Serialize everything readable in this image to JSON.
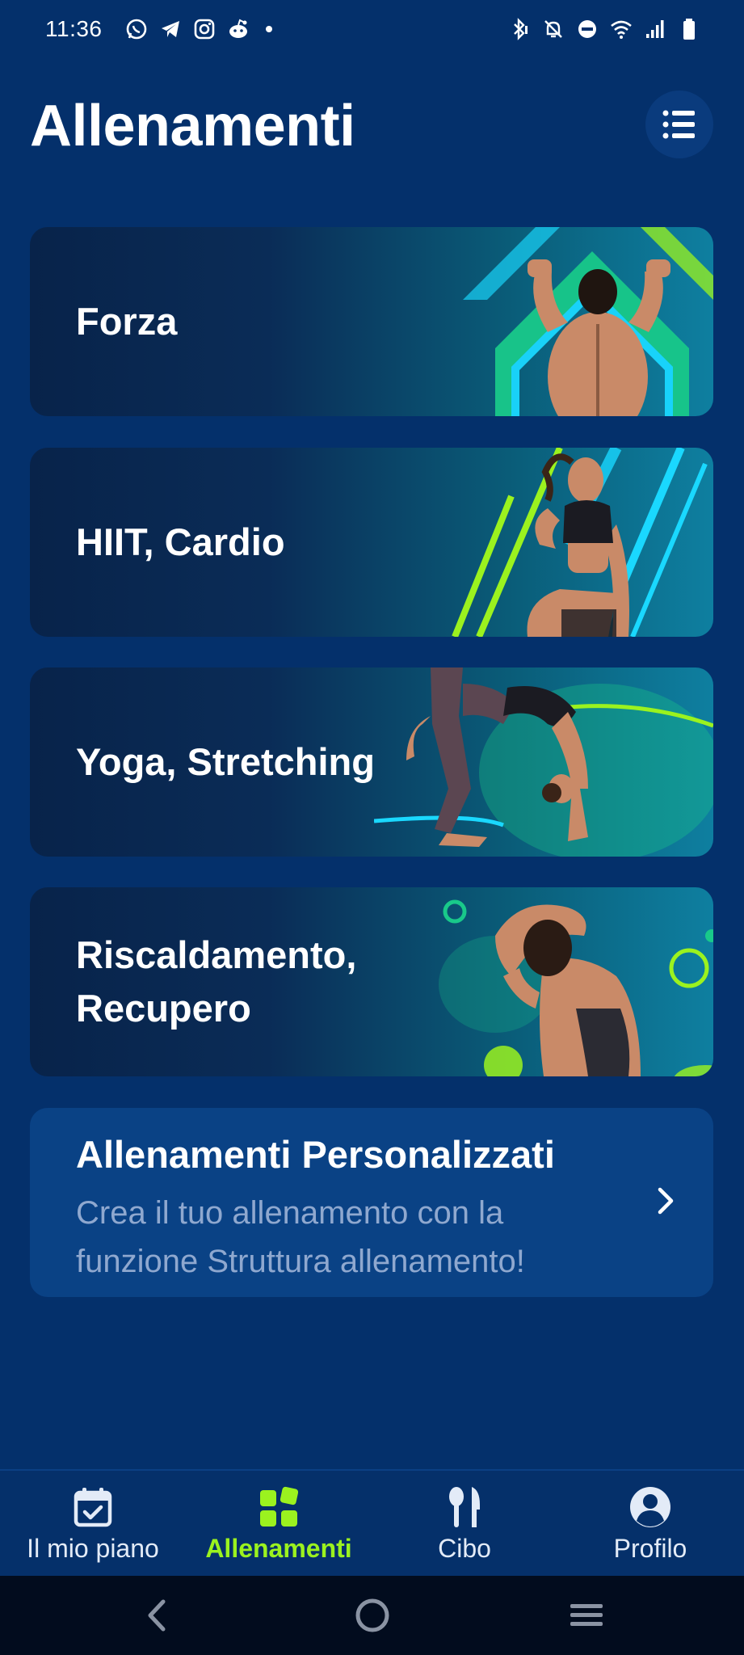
{
  "status_bar": {
    "time": "11:36",
    "left_icons": [
      "whatsapp-icon",
      "telegram-icon",
      "instagram-icon",
      "reddit-icon",
      "notification-dot-icon"
    ],
    "right_icons": [
      "bluetooth-icon",
      "bell-off-icon",
      "do-not-disturb-icon",
      "wifi-icon",
      "signal-icon",
      "battery-icon"
    ]
  },
  "header": {
    "title": "Allenamenti",
    "menu_icon": "list-icon"
  },
  "categories": [
    {
      "label": "Forza"
    },
    {
      "label": "HIIT, Cardio"
    },
    {
      "label": "Yoga, Stretching"
    },
    {
      "label": "Riscaldamento,\nRecupero"
    }
  ],
  "custom": {
    "title": "Allenamenti Personalizzati",
    "subtitle": "Crea il tuo allenamento con la funzione Struttura allenamento!"
  },
  "bottom_nav": {
    "items": [
      {
        "label": "Il mio piano",
        "icon": "calendar-check-icon"
      },
      {
        "label": "Allenamenti",
        "icon": "grid-icon",
        "active": true
      },
      {
        "label": "Cibo",
        "icon": "fork-knife-icon"
      },
      {
        "label": "Profilo",
        "icon": "profile-icon"
      }
    ]
  },
  "colors": {
    "background": "#04306b",
    "active_nav": "#9bf21f",
    "subtitle": "#8fa8cf",
    "custom_card": "#0a4285"
  }
}
